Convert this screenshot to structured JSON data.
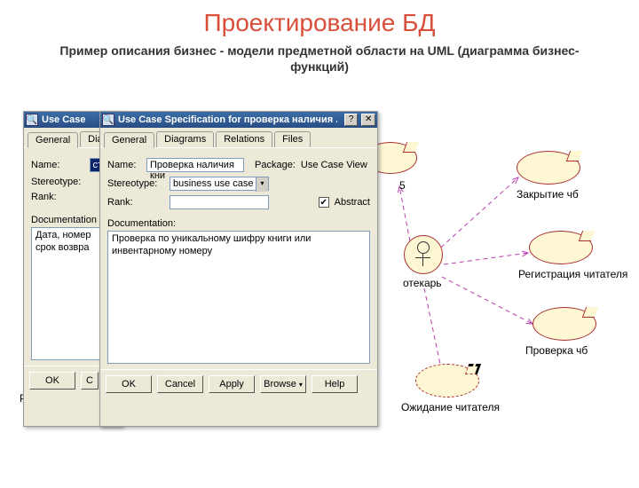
{
  "slide": {
    "title": "Проектирование БД",
    "subtitle": "Пример описания бизнес - модели предметной области на UML (диаграмма бизнес-функций)"
  },
  "dialog1": {
    "title": "Use Case",
    "tabs": {
      "general": "General",
      "diagrams": "Dia"
    },
    "labels": {
      "name": "Name:",
      "stereotype": "Stereotype:",
      "rank": "Rank:",
      "documentation": "Documentation"
    },
    "values": {
      "name": "стр",
      "documentation": "Дата, номер срок возвра"
    },
    "buttons": {
      "ok": "OK",
      "cancel": "C"
    }
  },
  "dialog2": {
    "title": "Use Case Specification for проверка наличия ...",
    "tabs": {
      "general": "General",
      "diagrams": "Diagrams",
      "relations": "Relations",
      "files": "Files"
    },
    "labels": {
      "name": "Name:",
      "package": "Package:",
      "stereotype": "Stereotype:",
      "rank": "Rank:",
      "documentation": "Documentation:",
      "abstract": "Abstract"
    },
    "values": {
      "name": "Проверка наличия кни",
      "package": "Use Case View",
      "stereotype": "business use case",
      "documentation": "Проверка по уникальному шифру книги или инвентарному номеру"
    },
    "buttons": {
      "ok": "OK",
      "cancel": "Cancel",
      "apply": "Apply",
      "browse": "Browse",
      "help": "Help"
    }
  },
  "diagram": {
    "actor": "отекарь",
    "usecases": {
      "close": "Закрытие чб",
      "register": "Регистрация читателя",
      "check": "Проверка чб",
      "wait": "Ожидание читателя",
      "re_prefix": "Ре",
      "cut_number": "5"
    }
  }
}
